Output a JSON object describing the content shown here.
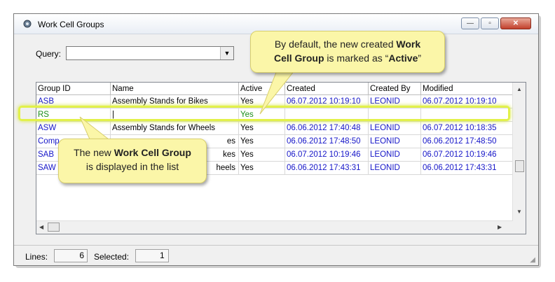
{
  "window": {
    "title": "Work Cell Groups",
    "min_symbol": "—",
    "max_symbol": "▫",
    "close_symbol": "✕"
  },
  "query": {
    "label": "Query:",
    "value": ""
  },
  "grid": {
    "columns": [
      "Group ID",
      "Name",
      "Active",
      "Created",
      "Created By",
      "Modified"
    ],
    "rows": [
      [
        "ASB",
        "Assembly Stands for Bikes",
        "Yes",
        "06.07.2012 10:19:10",
        "LEONID",
        "06.07.2012 10:19:10"
      ],
      [
        "RS",
        "|",
        "Yes",
        "",
        "",
        ""
      ],
      [
        "ASW",
        "Assembly Stands for Wheels",
        "Yes",
        "06.06.2012 17:40:48",
        "LEONID",
        "06.07.2012 10:18:35"
      ],
      [
        "Comp",
        "es",
        "Yes",
        "06.06.2012 17:48:50",
        "LEONID",
        "06.06.2012 17:48:50"
      ],
      [
        "SAB",
        "kes",
        "Yes",
        "06.07.2012 10:19:46",
        "LEONID",
        "06.07.2012 10:19:46"
      ],
      [
        "SAW",
        "heels",
        "Yes",
        "06.06.2012 17:43:31",
        "LEONID",
        "06.06.2012 17:43:31"
      ]
    ]
  },
  "status": {
    "lines_label": "Lines:",
    "lines_value": "6",
    "selected_label": "Selected:",
    "selected_value": "1"
  },
  "callouts": {
    "top_part1": "By default, the new created ",
    "top_bold1": "Work",
    "top_bold2": "Cell Group",
    "top_part2": " is marked as “",
    "top_bold3": "Active",
    "top_part3": "”",
    "bottom_part1": "The new ",
    "bottom_bold": "Work Cell Group",
    "bottom_part2": "is displayed in the list"
  },
  "colors": {
    "link_blue": "#1515c8",
    "new_row_green": "#1a8c1a",
    "highlight": "#e2f14a",
    "callout_bg": "#fbf6a8"
  }
}
